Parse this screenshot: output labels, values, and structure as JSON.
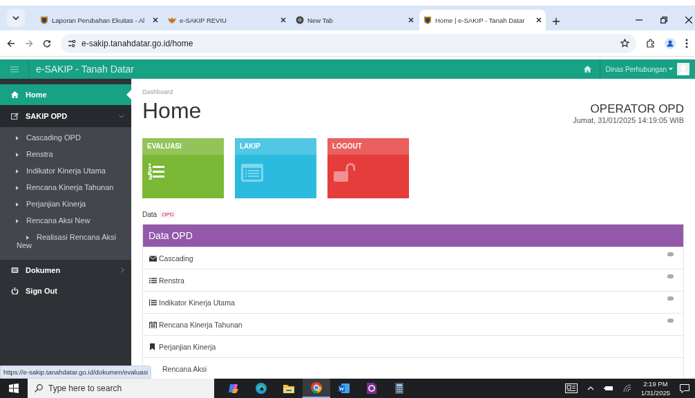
{
  "browser": {
    "tabs": [
      {
        "title": "Laporan Perubahan Ekuitas - Al",
        "kind": "shield",
        "selected": false
      },
      {
        "title": "e-SAKIP REVIU",
        "kind": "bird",
        "selected": false
      },
      {
        "title": "New Tab",
        "kind": "chrome",
        "selected": false
      },
      {
        "title": "Home | e-SAKIP - Tanah Datar",
        "kind": "shield",
        "selected": true
      }
    ],
    "address": "e-sakip.tanahdatar.go.id/home"
  },
  "app": {
    "brand": "e-SAKIP - Tanah Datar",
    "user": "Dinas Perhubungan",
    "sidebar": {
      "items": [
        {
          "label": "Home",
          "kind": "home",
          "selected": true
        },
        {
          "label": "SAKIP OPD",
          "kind": "edit",
          "selected": false,
          "expanded": true,
          "children": [
            {
              "label": "Cascading OPD"
            },
            {
              "label": "Renstra"
            },
            {
              "label": "Indikator Kinerja Utama"
            },
            {
              "label": "Rencana Kinerja Tahunan"
            },
            {
              "label": "Perjanjian Kinerja"
            },
            {
              "label": "Rencana Aksi New"
            },
            {
              "label": "Realisasi Rencana Aksi New"
            }
          ]
        },
        {
          "label": "Dokumen",
          "kind": "doc",
          "selected": false,
          "expanded": false
        },
        {
          "label": "Sign Out",
          "kind": "power",
          "selected": false
        }
      ]
    },
    "breadcrumb": "Dashboard",
    "page_title": "Home",
    "role": "OPERATOR OPD",
    "datetime": "Jumat, 31/01/2025 14:19:05 WIB",
    "tiles": [
      {
        "title": "EVALUASI",
        "kind": "list",
        "color": "#7ab835"
      },
      {
        "title": "LAKIP",
        "kind": "browser",
        "color": "#2bbbdf"
      },
      {
        "title": "LOGOUT",
        "kind": "lock",
        "color": "#e63c3c"
      }
    ],
    "data_label": "Data",
    "data_tag": "OPD",
    "panel": {
      "title": "Data OPD",
      "rows": [
        {
          "label": "Cascading",
          "kind": "envelope",
          "badge": true
        },
        {
          "label": "Renstra",
          "kind": "list",
          "badge": true
        },
        {
          "label": "Indikator Kinerja Utama",
          "kind": "listbar",
          "badge": true
        },
        {
          "label": "Rencana Kinerja Tahunan",
          "kind": "calendar",
          "badge": true
        },
        {
          "label": "Perjanjian Kinerja",
          "kind": "bookmark",
          "badge": false
        },
        {
          "label": "Rencana Aksi",
          "kind": "none",
          "badge": false
        }
      ]
    },
    "status_url": "https://e-sakip.tanahdatar.go.id/dokumen/evaluasi"
  },
  "taskbar": {
    "search_placeholder": "Type here to search",
    "time": "2:19 PM",
    "date": "1/31/2025",
    "apps": [
      {
        "kind": "copilot",
        "selected": false
      },
      {
        "kind": "edge",
        "selected": false
      },
      {
        "kind": "folder",
        "selected": false
      },
      {
        "kind": "chrome",
        "selected": true
      },
      {
        "kind": "word",
        "selected": false
      },
      {
        "kind": "pdf",
        "selected": false
      },
      {
        "kind": "calc",
        "selected": false
      }
    ]
  }
}
